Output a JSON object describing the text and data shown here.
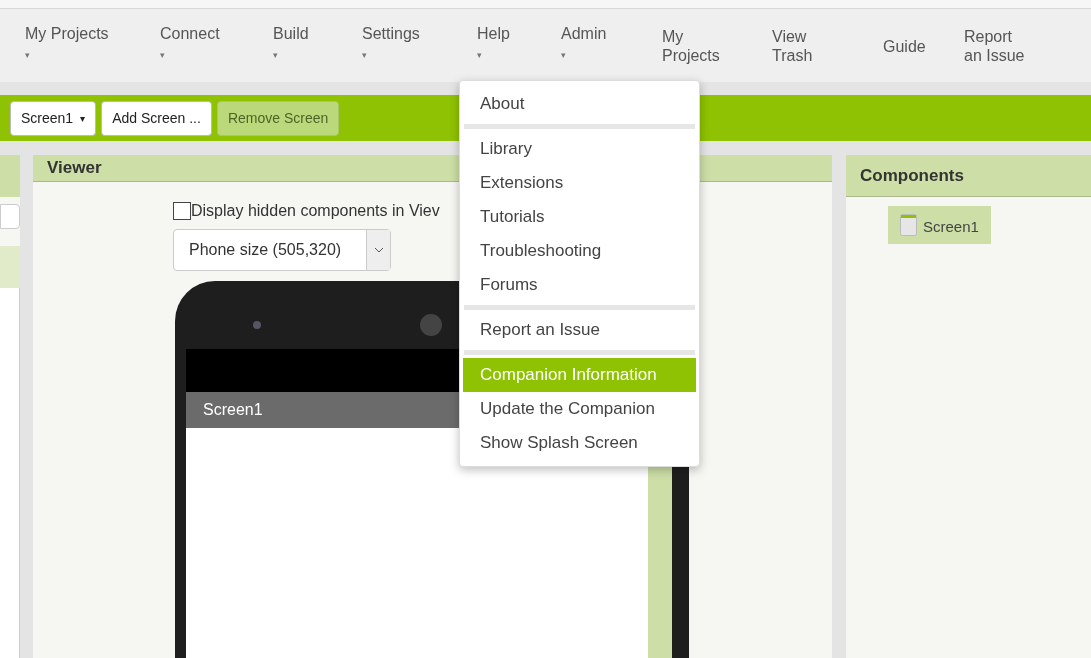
{
  "top_menu": [
    {
      "label": "My Projects",
      "has_caret": true
    },
    {
      "label": "Connect",
      "has_caret": true
    },
    {
      "label": "Build",
      "has_caret": true
    },
    {
      "label": "Settings",
      "has_caret": true
    },
    {
      "label": "Help",
      "has_caret": true
    },
    {
      "label": "Admin",
      "has_caret": true
    },
    {
      "label": "My Projects",
      "has_caret": false
    },
    {
      "label": "View Trash",
      "has_caret": false
    },
    {
      "label": "Guide",
      "has_caret": false
    },
    {
      "label": "Report an Issue",
      "has_caret": false
    }
  ],
  "toolbar": {
    "screen_select": "Screen1",
    "caret": "▾",
    "buttons": [
      {
        "label": "Add Screen ...",
        "disabled": false
      },
      {
        "label": "Remove Screen",
        "disabled": true
      }
    ]
  },
  "viewer": {
    "title": "Viewer",
    "hidden_checkbox": {
      "label": "Display hidden components in Viev",
      "checked": false
    },
    "size_select": "Phone size (505,320)",
    "phone_title": "Screen1"
  },
  "components": {
    "title": "Components",
    "tree": [
      {
        "label": "Screen1",
        "selected": true
      }
    ]
  },
  "help_menu": [
    {
      "kind": "item",
      "label": "About",
      "selected": false
    },
    {
      "kind": "separator"
    },
    {
      "kind": "item",
      "label": "Library",
      "selected": false
    },
    {
      "kind": "item",
      "label": "Extensions",
      "selected": false
    },
    {
      "kind": "item",
      "label": "Tutorials",
      "selected": false
    },
    {
      "kind": "item",
      "label": "Troubleshooting",
      "selected": false
    },
    {
      "kind": "item",
      "label": "Forums",
      "selected": false
    },
    {
      "kind": "separator"
    },
    {
      "kind": "item",
      "label": "Report an Issue",
      "selected": false
    },
    {
      "kind": "separator"
    },
    {
      "kind": "item",
      "label": "Companion Information",
      "selected": true
    },
    {
      "kind": "item",
      "label": "Update the Companion",
      "selected": false
    },
    {
      "kind": "item",
      "label": "Show Splash Screen",
      "selected": false
    }
  ]
}
